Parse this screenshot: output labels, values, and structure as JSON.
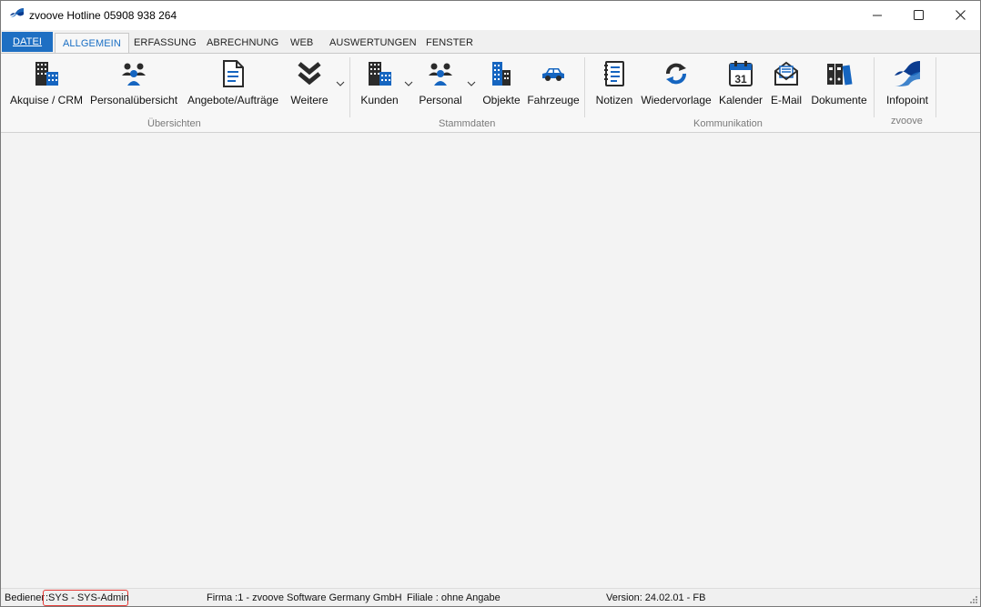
{
  "window": {
    "title": "zvoove Hotline 05908 938 264"
  },
  "tabs": [
    {
      "label": "DATEI"
    },
    {
      "label": "ALLGEMEIN"
    },
    {
      "label": "ERFASSUNG"
    },
    {
      "label": "ABRECHNUNG"
    },
    {
      "label": "WEB"
    },
    {
      "label": "AUSWERTUNGEN"
    },
    {
      "label": "FENSTER"
    }
  ],
  "ribbon": {
    "groups": [
      {
        "label": "Übersichten"
      },
      {
        "label": "Stammdaten"
      },
      {
        "label": "Kommunikation"
      },
      {
        "label": "zvoove"
      }
    ],
    "buttons": [
      {
        "label": "Akquise / CRM",
        "icon": "building-icon"
      },
      {
        "label": "Personalübersicht",
        "icon": "people-group-icon"
      },
      {
        "label": "Angebote/Aufträge",
        "icon": "document-icon"
      },
      {
        "label": "Weitere",
        "icon": "double-chevron-down-icon"
      },
      {
        "label": "Kunden",
        "icon": "building-icon"
      },
      {
        "label": "Personal",
        "icon": "people-group-icon"
      },
      {
        "label": "Objekte",
        "icon": "office-tower-icon"
      },
      {
        "label": "Fahrzeuge",
        "icon": "car-icon"
      },
      {
        "label": "Notizen",
        "icon": "notepad-icon"
      },
      {
        "label": "Wiedervorlage",
        "icon": "refresh-arrows-icon"
      },
      {
        "label": "Kalender",
        "icon": "calendar-icon",
        "day": "31"
      },
      {
        "label": "E-Mail",
        "icon": "envelope-icon"
      },
      {
        "label": "Dokumente",
        "icon": "binders-icon"
      },
      {
        "label": "Infopoint",
        "icon": "zvoove-logo-icon"
      }
    ]
  },
  "status": {
    "user_label": "Bediener",
    "user_value": ":SYS - SYS-Admin",
    "firma": "Firma :1 - zvoove Software Germany GmbH",
    "filiale": "Filiale : ohne Angabe",
    "version": "Version: 24.02.01 - FB"
  },
  "colors": {
    "accent": "#1e6fc3",
    "icon_blue": "#1565c0",
    "icon_dark": "#2b2b2b",
    "highlight": "#e53935"
  }
}
